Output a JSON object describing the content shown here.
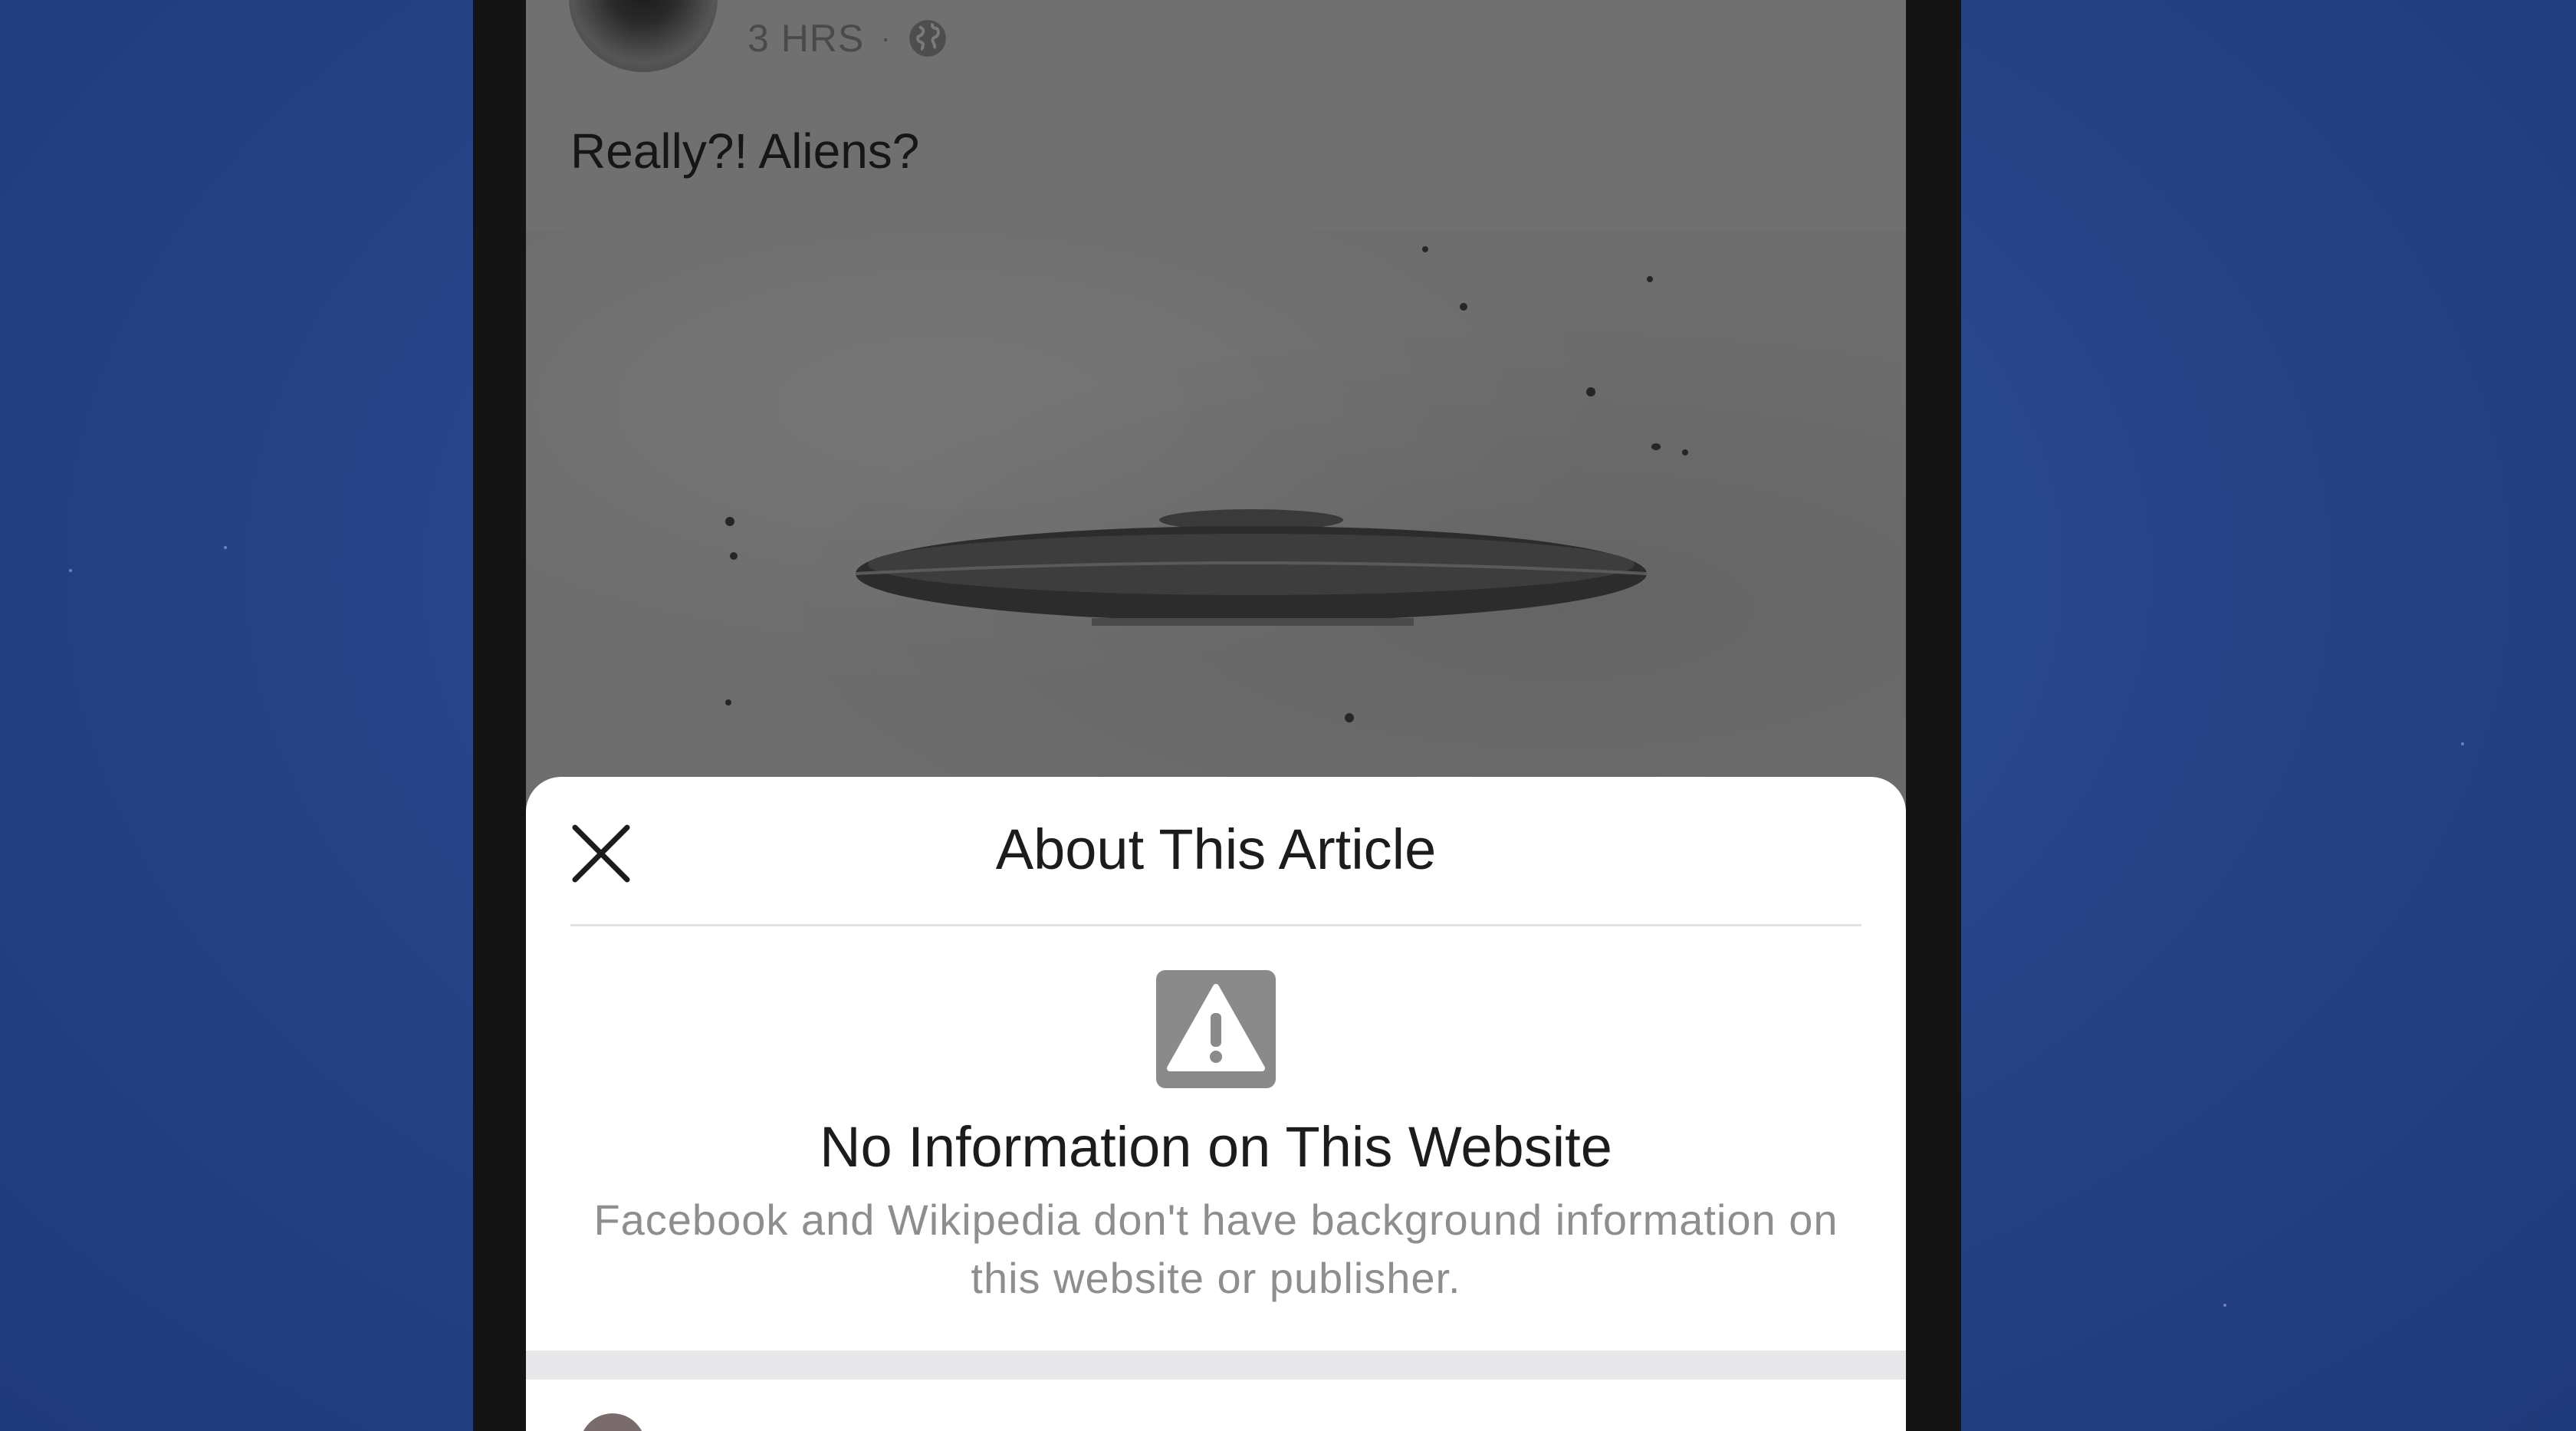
{
  "post": {
    "time": "3 HRS",
    "separator": "·",
    "privacy_icon": "globe-icon",
    "text": "Really?! Aliens?",
    "image_icon": "ufo-photo"
  },
  "about_sheet": {
    "title": "About This Article",
    "close_icon": "close-icon",
    "warning_icon": "warning-icon",
    "heading": "No Information on This Website",
    "body": "Facebook and Wikipedia don't have background information on this website or publisher."
  },
  "colors": {
    "backdrop": "#2a4788",
    "sheet_background": "#ffffff",
    "warning_icon_bg": "#8a8a8a",
    "body_text": "#8e8e8e"
  }
}
